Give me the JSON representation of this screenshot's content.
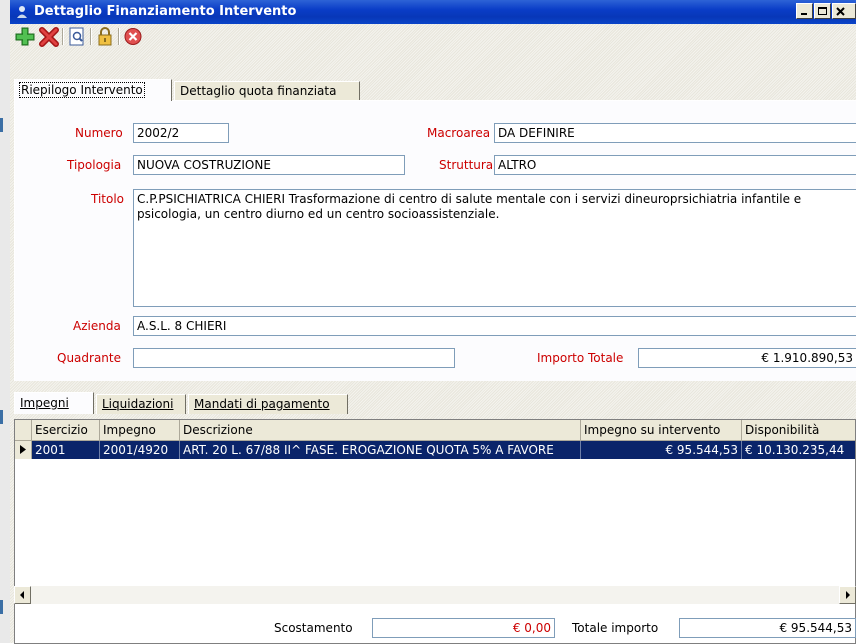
{
  "window": {
    "title": "Dettaglio Finanziamento Intervento"
  },
  "toolbar": {
    "icons": [
      "add-icon",
      "delete-icon",
      "preview-icon",
      "lock-icon",
      "close-icon"
    ]
  },
  "tabs_top": [
    {
      "label": "Riepilogo Intervento",
      "active": true
    },
    {
      "label": "Dettaglio quota finanziata",
      "active": false
    }
  ],
  "form": {
    "numero_label": "Numero",
    "numero_value": "2002/2",
    "macroarea_label": "Macroarea",
    "macroarea_value": "DA DEFINIRE",
    "tipologia_label": "Tipologia",
    "tipologia_value": "NUOVA COSTRUZIONE",
    "struttura_label": "Struttura",
    "struttura_value": "ALTRO",
    "titolo_label": "Titolo",
    "titolo_value": "C.P.PSICHIATRICA  CHIERI Trasformazione di centro di salute mentale con i servizi dineuroprsichiatria infantile e psicologia, un centro diurno ed un centro socioassistenziale.",
    "azienda_label": "Azienda",
    "azienda_value": "A.S.L. 8 CHIERI",
    "quadrante_label": "Quadrante",
    "quadrante_value": "",
    "importo_label": "Importo Totale",
    "importo_value": "€ 1.910.890,53"
  },
  "tabs_bottom": [
    {
      "label": "Impegni",
      "active": true
    },
    {
      "label": "Liquidazioni",
      "active": false
    },
    {
      "label": "Mandati di pagamento",
      "active": false
    }
  ],
  "grid": {
    "columns": [
      "Esercizio",
      "Impegno",
      "Descrizione",
      "Impegno su intervento",
      "Disponibilità"
    ],
    "rows": [
      [
        "2001",
        "2001/4920",
        "ART. 20 L. 67/88 II^ FASE. EROGAZIONE QUOTA 5% A FAVORE",
        "€ 95.544,53",
        "€ 10.130.235,44"
      ]
    ]
  },
  "footer": {
    "scostamento_label": "Scostamento",
    "scostamento_value": "€ 0,00",
    "totale_label": "Totale importo",
    "totale_value": "€ 95.544,53"
  },
  "colors": {
    "title_bar": "#0a3dc7",
    "selection": "#0a246a",
    "required_label": "#cc0000"
  }
}
